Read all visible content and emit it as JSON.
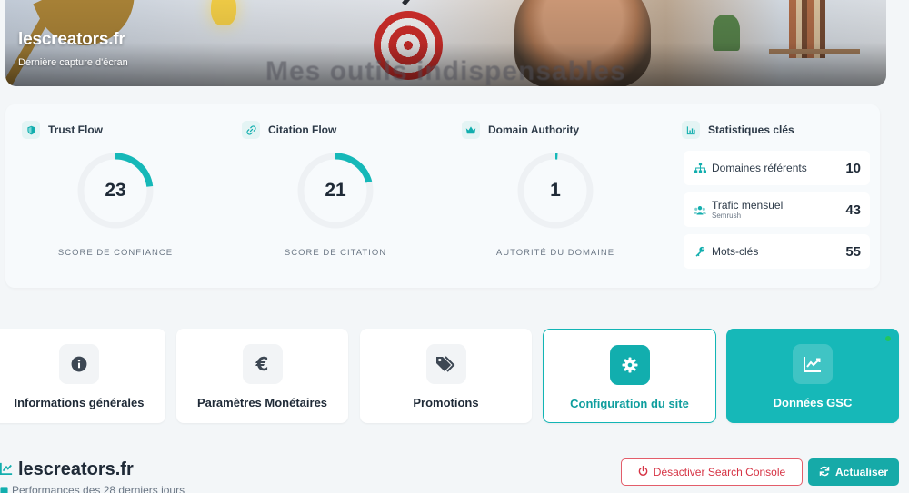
{
  "hero": {
    "site_name": "lescreators.fr",
    "subtitle": "Dernière capture d'écran",
    "banner_text": "Mes outils indispensables"
  },
  "metrics": [
    {
      "title": "Trust Flow",
      "value": "23",
      "caption": "SCORE DE CONFIANCE",
      "icon": "shield-icon",
      "gauge_fraction": 0.23
    },
    {
      "title": "Citation Flow",
      "value": "21",
      "caption": "SCORE DE CITATION",
      "icon": "link-icon",
      "gauge_fraction": 0.21
    },
    {
      "title": "Domain Authority",
      "value": "1",
      "caption": "AUTORITÉ DU DOMAINE",
      "icon": "crown-icon",
      "gauge_fraction": 0.01
    }
  ],
  "key_stats": {
    "title": "Statistiques clés",
    "icon": "chart-icon",
    "items": [
      {
        "label": "Domaines référents",
        "sub": "",
        "value": "10",
        "icon": "sitemap-icon"
      },
      {
        "label": "Trafic mensuel",
        "sub": "Semrush",
        "value": "43",
        "icon": "users-icon"
      },
      {
        "label": "Mots-clés",
        "sub": "",
        "value": "55",
        "icon": "key-icon"
      }
    ]
  },
  "nav": [
    {
      "label": "Informations générales",
      "icon": "info-icon",
      "state": "default"
    },
    {
      "label": "Paramètres Monétaires",
      "icon": "euro-icon",
      "state": "default"
    },
    {
      "label": "Promotions",
      "icon": "tags-icon",
      "state": "default"
    },
    {
      "label": "Configuration du site",
      "icon": "gear-icon",
      "state": "outlined"
    },
    {
      "label": "Données GSC",
      "icon": "chart-line-icon",
      "state": "filled"
    }
  ],
  "section": {
    "title": "lescreators.fr",
    "subtitle": "Performances des 28 derniers jours"
  },
  "buttons": {
    "deactivate": "Désactiver Search Console",
    "refresh": "Actualiser"
  },
  "colors": {
    "accent": "#16b8b8",
    "danger": "#d63344",
    "gauge_track": "#eef1f4"
  }
}
